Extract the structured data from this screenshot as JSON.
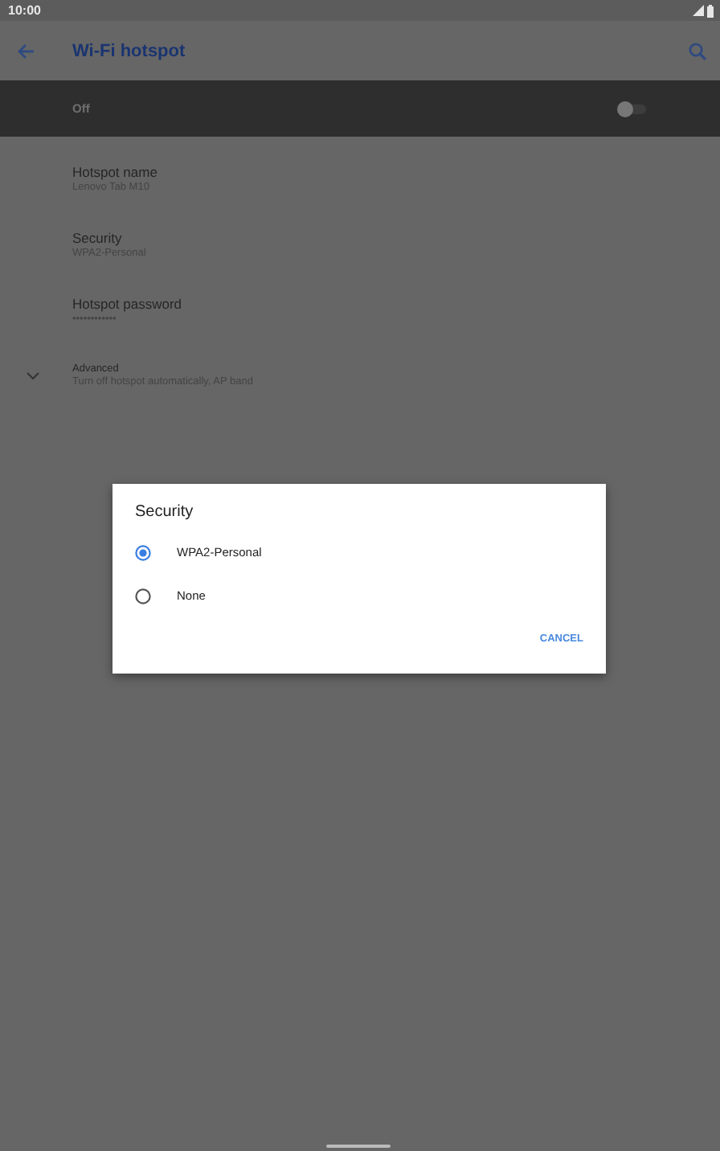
{
  "status_bar": {
    "time": "10:00"
  },
  "toolbar": {
    "title": "Wi-Fi hotspot"
  },
  "master_switch": {
    "label": "Off",
    "on": false
  },
  "settings": [
    {
      "title": "Hotspot name",
      "summary": "Lenovo Tab M10",
      "expandable": false
    },
    {
      "title": "Security",
      "summary": "WPA2-Personal",
      "expandable": false
    },
    {
      "title": "Hotspot password",
      "summary": "••••••••••••",
      "expandable": false
    },
    {
      "title": "Advanced",
      "summary": "Turn off hotspot automatically, AP band",
      "expandable": true
    }
  ],
  "dialog": {
    "title": "Security",
    "options": [
      {
        "label": "WPA2-Personal",
        "selected": true
      },
      {
        "label": "None",
        "selected": false
      }
    ],
    "buttons": [
      "CANCEL"
    ]
  }
}
